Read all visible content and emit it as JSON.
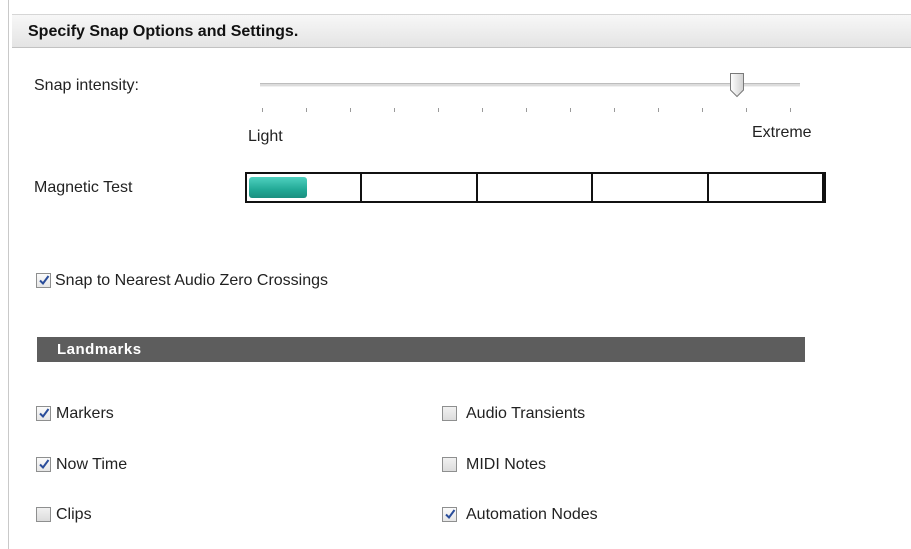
{
  "header": {
    "title": "Specify Snap Options and Settings."
  },
  "snap_intensity": {
    "label": "Snap intensity:",
    "min_label": "Light",
    "max_label": "Extreme",
    "value_fraction": 0.9,
    "tick_count": 13
  },
  "magnetic_test": {
    "label": "Magnetic Test",
    "segments": 5,
    "fill_fraction": 0.1,
    "fill_color": "#22a996"
  },
  "zero_crossings": {
    "label": "Snap to Nearest Audio Zero Crossings",
    "checked": true
  },
  "landmarks": {
    "title": "Landmarks",
    "bar_color": "#5d5d5d",
    "items": [
      {
        "label": "Markers",
        "checked": true
      },
      {
        "label": "Audio Transients",
        "checked": false
      },
      {
        "label": "Now Time",
        "checked": true
      },
      {
        "label": "MIDI Notes",
        "checked": false
      },
      {
        "label": "Clips",
        "checked": false
      },
      {
        "label": "Automation Nodes",
        "checked": true
      }
    ]
  }
}
